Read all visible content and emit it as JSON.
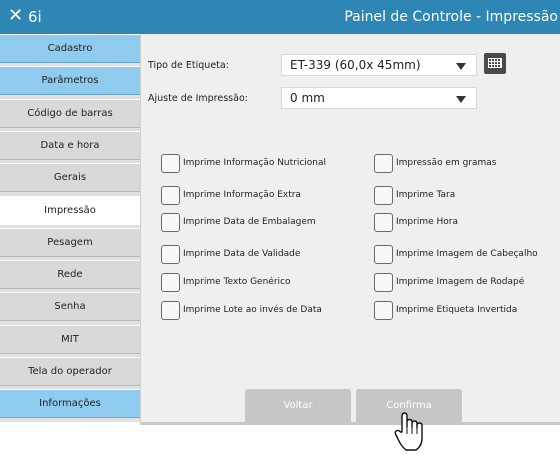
{
  "titlebar": {
    "close_symbol": "✕",
    "app_name": "6i",
    "title": "Painel de Controle - Impressão"
  },
  "sidebar": {
    "items": [
      {
        "label": "Cadastro",
        "style": "blue"
      },
      {
        "label": "Parâmetros",
        "style": "blue"
      },
      {
        "label": "Código de barras",
        "style": "gray"
      },
      {
        "label": "Data e hora",
        "style": "gray"
      },
      {
        "label": "Gerais",
        "style": "gray"
      },
      {
        "label": "Impressão",
        "style": "active"
      },
      {
        "label": "Pesagem",
        "style": "gray"
      },
      {
        "label": "Rede",
        "style": "gray"
      },
      {
        "label": "Senha",
        "style": "gray"
      },
      {
        "label": "MIT",
        "style": "gray"
      },
      {
        "label": "Tela do operador",
        "style": "gray"
      },
      {
        "label": "Informações",
        "style": "blue"
      }
    ]
  },
  "form": {
    "label_type": {
      "label": "Tipo de Etiqueta:",
      "value": "ET-339 (60,0x  45mm)"
    },
    "print_adjust": {
      "label": "Ajuste de Impressão:",
      "value": "0 mm"
    },
    "keyboard_icon": "keyboard-icon"
  },
  "checkboxes": {
    "left": [
      {
        "label": "Imprime Informação Nutricional",
        "checked": false
      },
      {
        "label": "Imprime Informação Extra",
        "checked": false
      },
      {
        "label": "Imprime Data de Embalagem",
        "checked": false
      },
      {
        "label": "Imprime Data de Validade",
        "checked": false
      },
      {
        "label": "Imprime Texto Genérico",
        "checked": false
      },
      {
        "label": "Imprime Lote ao invés de Data",
        "checked": false
      }
    ],
    "right": [
      {
        "label": "Impressão em gramas",
        "checked": false
      },
      {
        "label": "Imprime Tara",
        "checked": false
      },
      {
        "label": "Imprime Hora",
        "checked": false
      },
      {
        "label": "Imprime Imagem de Cabeçalho",
        "checked": false
      },
      {
        "label": "Imprime Imagem de Rodapé",
        "checked": false
      },
      {
        "label": "Imprime Etiqueta Invertida",
        "checked": false
      }
    ]
  },
  "buttons": {
    "back": "Voltar",
    "confirm": "Confirma"
  },
  "colors": {
    "titlebar": "#2e86b4",
    "sidebar_blue": "#8fcbee",
    "sidebar_gray": "#d9d9d9",
    "button": "#c6c6c6"
  }
}
